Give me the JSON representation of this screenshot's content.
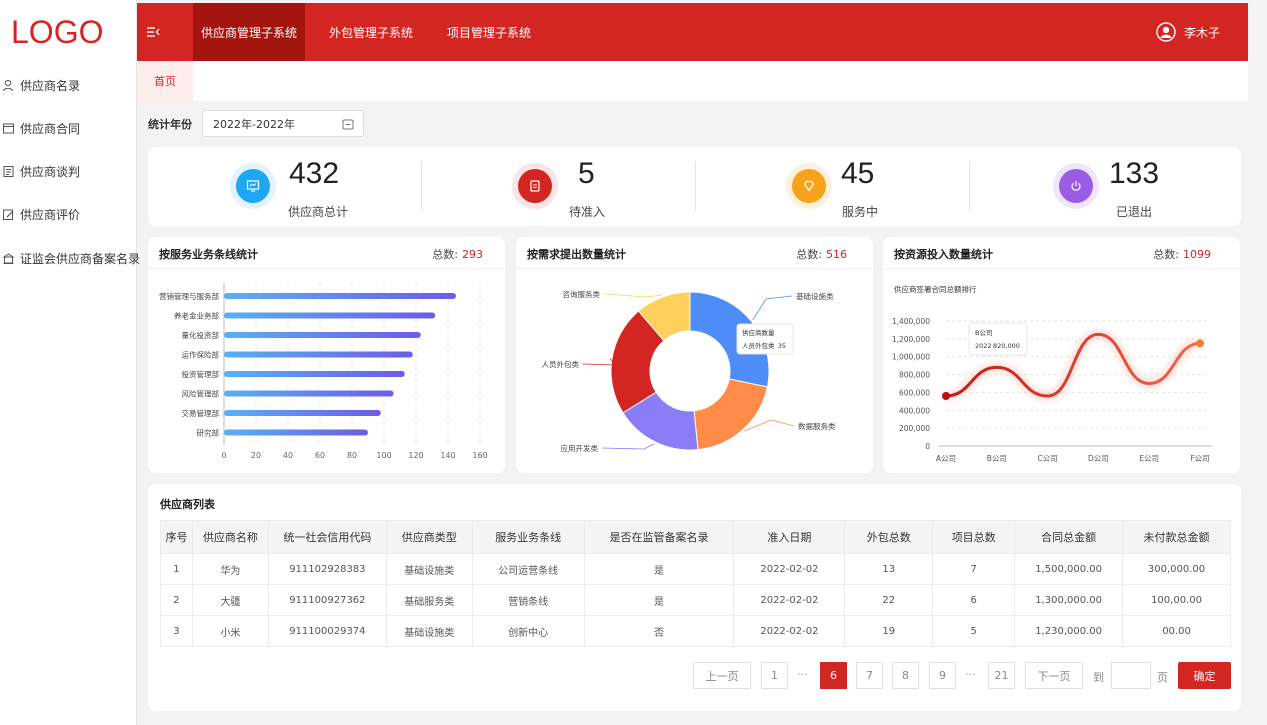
{
  "logo": "LOGO",
  "sidebar": {
    "items": [
      {
        "label": "供应商名录"
      },
      {
        "label": "供应商合同"
      },
      {
        "label": "供应商谈判"
      },
      {
        "label": "供应商评价"
      },
      {
        "label": "证监会供应商备案名录"
      }
    ]
  },
  "header": {
    "nav": [
      "供应商管理子系统",
      "外包管理子系统",
      "项目管理子系统"
    ],
    "user_name": "李木子"
  },
  "tabs": [
    "首页"
  ],
  "filter": {
    "label": "统计年份",
    "value": "2022年-2022年"
  },
  "stats": [
    {
      "value": "432",
      "label": "供应商总计",
      "color": "#1ea7f5",
      "ring": "#e2f3fd",
      "icon": "monitor-icon"
    },
    {
      "value": "5",
      "label": "待准入",
      "color": "#d32522",
      "ring": "#fbe4e4",
      "icon": "document-icon"
    },
    {
      "value": "45",
      "label": "服务中",
      "color": "#f7a21b",
      "ring": "#fdf0dc",
      "icon": "diamond-icon"
    },
    {
      "value": "133",
      "label": "已退出",
      "color": "#9b5de5",
      "ring": "#efe6fb",
      "icon": "power-icon"
    }
  ],
  "charts": {
    "bar": {
      "title": "按服务业务条线统计",
      "total_label": "总数:",
      "total_value": "293"
    },
    "pie": {
      "title": "按需求提出数量统计",
      "total_label": "总数:",
      "total_value": "516"
    },
    "line": {
      "title": "按资源投入数量统计",
      "total_label": "总数:",
      "total_value": "1099"
    }
  },
  "chart_data": [
    {
      "type": "bar",
      "orientation": "horizontal",
      "categories": [
        "营销管理与服务部",
        "养老金业务部",
        "量化投资部",
        "运作保险部",
        "投资管理部",
        "风险管理部",
        "交易管理部",
        "研究部"
      ],
      "values": [
        145,
        132,
        123,
        118,
        113,
        106,
        98,
        90
      ],
      "xlim": [
        0,
        160
      ],
      "xticks": [
        "0",
        "20",
        "40",
        "60",
        "80",
        "100",
        "120",
        "140",
        "160"
      ],
      "grid": true,
      "colors": [
        "#5ab0f2",
        "#6c5ce7"
      ]
    },
    {
      "type": "pie",
      "donut": true,
      "labels": [
        "基础设施类",
        "数据服务类",
        "应用开发类",
        "人员外包类",
        "咨询服务类"
      ],
      "values": [
        35,
        25,
        22,
        28,
        14
      ],
      "colors": [
        "#4e8cf7",
        "#ff8b48",
        "#8b7df5",
        "#d32522",
        "#ffd05b"
      ],
      "tooltip": {
        "title": "供应商数量",
        "label": "人员外包类",
        "value": "35"
      }
    },
    {
      "type": "line",
      "subtitle": "供应商签署合同总额排行",
      "categories": [
        "A公司",
        "B公司",
        "C公司",
        "D公司",
        "E公司",
        "F公司"
      ],
      "values": [
        560000,
        880000,
        560000,
        1250000,
        700000,
        1150000
      ],
      "ylim": [
        0,
        1400000
      ],
      "yticks": [
        "0",
        "200,000",
        "400,000",
        "600,000",
        "800,000",
        "1,000,000",
        "1,200,000",
        "1,400,000"
      ],
      "tooltip": {
        "title": "B公司",
        "label": "2022",
        "value": "820,000"
      },
      "color": "#d32522"
    }
  ],
  "table": {
    "title": "供应商列表",
    "headers": [
      "序号",
      "供应商名称",
      "统一社会信用代码",
      "供应商类型",
      "服务业务条线",
      "是否在监管备案名录",
      "准入日期",
      "外包总数",
      "项目总数",
      "合同总金额",
      "未付款总金额"
    ],
    "rows": [
      [
        "1",
        "华为",
        "911102928383",
        "基础设施类",
        "公司运营条线",
        "是",
        "2022-02-02",
        "13",
        "7",
        "1,500,000.00",
        "300,000.00"
      ],
      [
        "2",
        "大疆",
        "911100927362",
        "基础服务类",
        "营销条线",
        "是",
        "2022-02-02",
        "22",
        "6",
        "1,300,000.00",
        "100,00.00"
      ],
      [
        "3",
        "小米",
        "911100029374",
        "基础设施类",
        "创新中心",
        "否",
        "2022-02-02",
        "19",
        "5",
        "1,230,000.00",
        "00.00"
      ]
    ]
  },
  "pagination": {
    "prev": "上一页",
    "next": "下一页",
    "pages": [
      "1",
      "6",
      "7",
      "8",
      "9",
      "21"
    ],
    "ellipsis": "···",
    "current": "6",
    "goto_label": "到",
    "page_suffix": "页",
    "confirm": "确定"
  }
}
